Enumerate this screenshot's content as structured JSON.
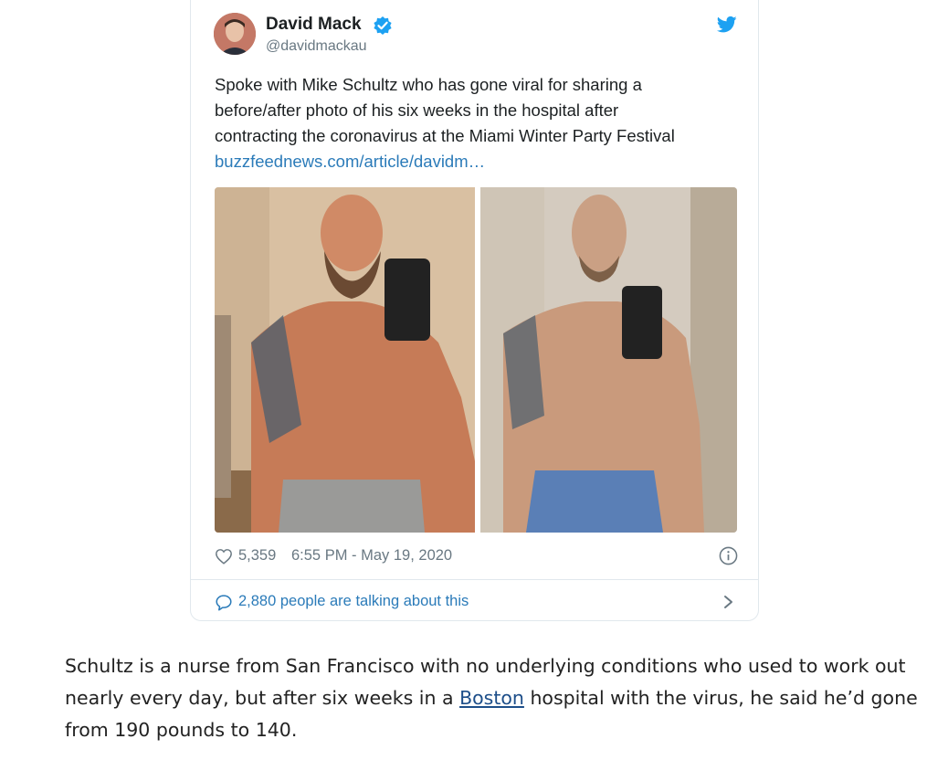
{
  "tweet": {
    "author_name": "David Mack",
    "author_handle": "@davidmackau",
    "text_lines": [
      "Spoke with Mike Schultz who has gone viral for sharing a",
      "before/after photo of his six weeks in the hospital after",
      "contracting the coronavirus at the Miami Winter Party Festival"
    ],
    "link_text": "buzzfeednews.com/article/davidm…",
    "likes": "5,359",
    "timestamp": "6:55 PM - May 19, 2020",
    "talking": "2,880 people are talking about this",
    "icons": [
      "verified-badge-icon",
      "twitter-bird-icon",
      "heart-icon",
      "info-icon",
      "speech-bubble-icon",
      "chevron-right-icon"
    ],
    "colors": {
      "link": "#2b7bb9",
      "muted": "#697882",
      "verified": "#1da1f2"
    }
  },
  "article": {
    "line1": "Schultz is a nurse from San Francisco with no underlying conditions who used to work out",
    "line2_before": "nearly every day, but after six weeks in a ",
    "link_text": "Boston",
    "line2_after": " hospital with the virus, he said he’d gone",
    "line3": "from 190 pounds to 140."
  }
}
